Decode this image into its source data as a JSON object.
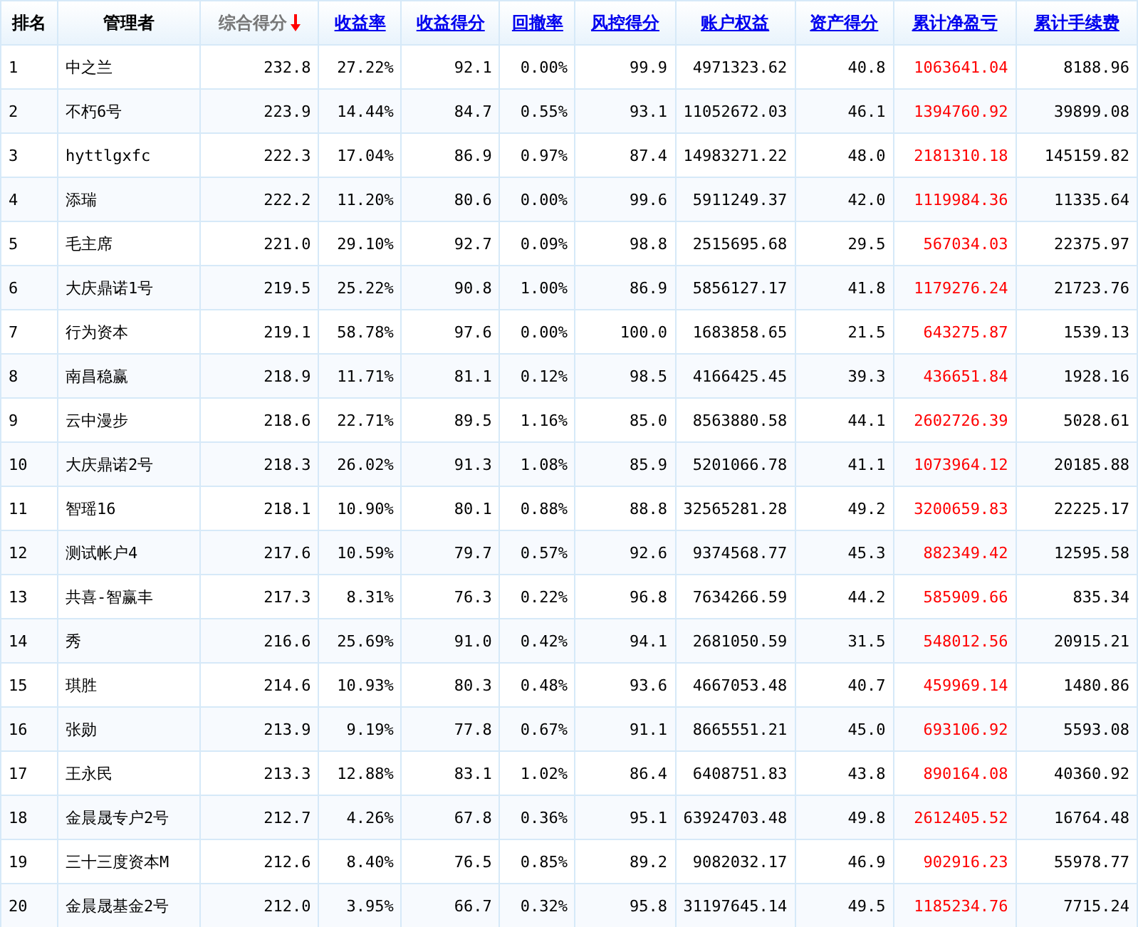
{
  "table": {
    "columns": [
      {
        "label": "排名",
        "kind": "plain"
      },
      {
        "label": "管理者",
        "kind": "plain"
      },
      {
        "label": "综合得分",
        "kind": "sorted"
      },
      {
        "label": "收益率",
        "kind": "link"
      },
      {
        "label": "收益得分",
        "kind": "link"
      },
      {
        "label": "回撤率",
        "kind": "link"
      },
      {
        "label": "风控得分",
        "kind": "link"
      },
      {
        "label": "账户权益",
        "kind": "link"
      },
      {
        "label": "资产得分",
        "kind": "link"
      },
      {
        "label": "累计净盈亏",
        "kind": "link",
        "color": "#ff0000"
      },
      {
        "label": "累计手续费",
        "kind": "link"
      }
    ],
    "rows": [
      [
        "1",
        "中之兰",
        "232.8",
        "27.22%",
        "92.1",
        "0.00%",
        "99.9",
        "4971323.62",
        "40.8",
        "1063641.04",
        "8188.96"
      ],
      [
        "2",
        "不朽6号",
        "223.9",
        "14.44%",
        "84.7",
        "0.55%",
        "93.1",
        "11052672.03",
        "46.1",
        "1394760.92",
        "39899.08"
      ],
      [
        "3",
        "hyttlgxfc",
        "222.3",
        "17.04%",
        "86.9",
        "0.97%",
        "87.4",
        "14983271.22",
        "48.0",
        "2181310.18",
        "145159.82"
      ],
      [
        "4",
        "添瑞",
        "222.2",
        "11.20%",
        "80.6",
        "0.00%",
        "99.6",
        "5911249.37",
        "42.0",
        "1119984.36",
        "11335.64"
      ],
      [
        "5",
        "毛主席",
        "221.0",
        "29.10%",
        "92.7",
        "0.09%",
        "98.8",
        "2515695.68",
        "29.5",
        "567034.03",
        "22375.97"
      ],
      [
        "6",
        "大庆鼎诺1号",
        "219.5",
        "25.22%",
        "90.8",
        "1.00%",
        "86.9",
        "5856127.17",
        "41.8",
        "1179276.24",
        "21723.76"
      ],
      [
        "7",
        "行为资本",
        "219.1",
        "58.78%",
        "97.6",
        "0.00%",
        "100.0",
        "1683858.65",
        "21.5",
        "643275.87",
        "1539.13"
      ],
      [
        "8",
        "南昌稳赢",
        "218.9",
        "11.71%",
        "81.1",
        "0.12%",
        "98.5",
        "4166425.45",
        "39.3",
        "436651.84",
        "1928.16"
      ],
      [
        "9",
        "云中漫步",
        "218.6",
        "22.71%",
        "89.5",
        "1.16%",
        "85.0",
        "8563880.58",
        "44.1",
        "2602726.39",
        "5028.61"
      ],
      [
        "10",
        "大庆鼎诺2号",
        "218.3",
        "26.02%",
        "91.3",
        "1.08%",
        "85.9",
        "5201066.78",
        "41.1",
        "1073964.12",
        "20185.88"
      ],
      [
        "11",
        "智瑶16",
        "218.1",
        "10.90%",
        "80.1",
        "0.88%",
        "88.8",
        "32565281.28",
        "49.2",
        "3200659.83",
        "22225.17"
      ],
      [
        "12",
        "测试帐户4",
        "217.6",
        "10.59%",
        "79.7",
        "0.57%",
        "92.6",
        "9374568.77",
        "45.3",
        "882349.42",
        "12595.58"
      ],
      [
        "13",
        "共喜-智赢丰",
        "217.3",
        "8.31%",
        "76.3",
        "0.22%",
        "96.8",
        "7634266.59",
        "44.2",
        "585909.66",
        "835.34"
      ],
      [
        "14",
        "秀",
        "216.6",
        "25.69%",
        "91.0",
        "0.42%",
        "94.1",
        "2681050.59",
        "31.5",
        "548012.56",
        "20915.21"
      ],
      [
        "15",
        "琪胜",
        "214.6",
        "10.93%",
        "80.3",
        "0.48%",
        "93.6",
        "4667053.48",
        "40.7",
        "459969.14",
        "1480.86"
      ],
      [
        "16",
        "张勋",
        "213.9",
        "9.19%",
        "77.8",
        "0.67%",
        "91.1",
        "8665551.21",
        "45.0",
        "693106.92",
        "5593.08"
      ],
      [
        "17",
        "王永民",
        "213.3",
        "12.88%",
        "83.1",
        "1.02%",
        "86.4",
        "6408751.83",
        "43.8",
        "890164.08",
        "40360.92"
      ],
      [
        "18",
        "金晨晟专户2号",
        "212.7",
        "4.26%",
        "67.8",
        "0.36%",
        "95.1",
        "63924703.48",
        "49.8",
        "2612405.52",
        "16764.48"
      ],
      [
        "19",
        "三十三度资本M",
        "212.6",
        "8.40%",
        "76.5",
        "0.85%",
        "89.2",
        "9082032.17",
        "46.9",
        "902916.23",
        "55978.77"
      ],
      [
        "20",
        "金晨晟基金2号",
        "212.0",
        "3.95%",
        "66.7",
        "0.32%",
        "95.8",
        "31197645.14",
        "49.5",
        "1185234.76",
        "7715.24"
      ]
    ]
  }
}
